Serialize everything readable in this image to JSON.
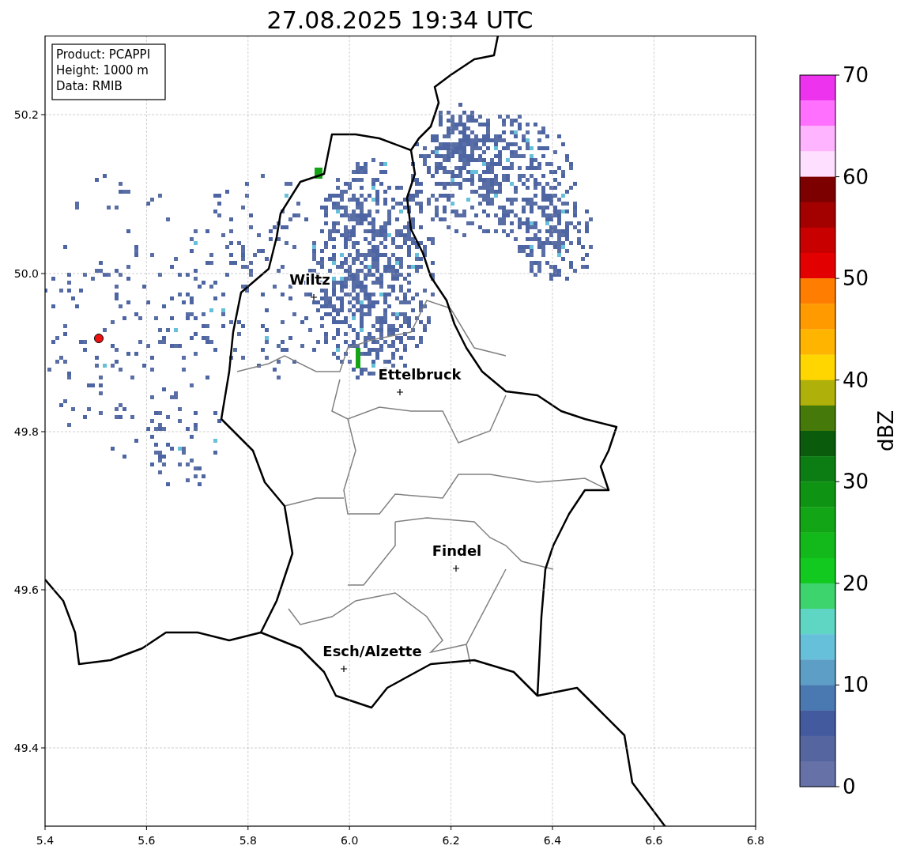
{
  "title": "27.08.2025 19:34 UTC",
  "info_box": [
    "Product: PCAPPI",
    "Height: 1000 m",
    "Data: RMIB"
  ],
  "map": {
    "x_ticks": [
      "5.4",
      "5.6",
      "5.8",
      "6.0",
      "6.2",
      "6.4",
      "6.6",
      "6.8"
    ],
    "y_ticks": [
      "50.2",
      "50.0",
      "49.8",
      "49.6",
      "49.4"
    ],
    "cities": [
      {
        "name": "Wiltz"
      },
      {
        "name": "Ettelbruck"
      },
      {
        "name": "Findel"
      },
      {
        "name": "Esch/Alzette"
      }
    ]
  },
  "colorbar": {
    "label": "dBZ",
    "ticks": [
      "70",
      "60",
      "50",
      "40",
      "30",
      "20",
      "10",
      "0"
    ],
    "segments": [
      {
        "color": "#ee33ee"
      },
      {
        "color": "#ff70ff"
      },
      {
        "color": "#ffb4ff"
      },
      {
        "color": "#ffdfff"
      },
      {
        "color": "#7d0000"
      },
      {
        "color": "#a30000"
      },
      {
        "color": "#c80000"
      },
      {
        "color": "#e30000"
      },
      {
        "color": "#ff7d00"
      },
      {
        "color": "#ff9a00"
      },
      {
        "color": "#ffb400"
      },
      {
        "color": "#ffd600"
      },
      {
        "color": "#b0b00a"
      },
      {
        "color": "#457a0a"
      },
      {
        "color": "#0a5c0c"
      },
      {
        "color": "#0c7d12"
      },
      {
        "color": "#0e9312"
      },
      {
        "color": "#12a515"
      },
      {
        "color": "#13b81a"
      },
      {
        "color": "#12c91f"
      },
      {
        "color": "#3dd46e"
      },
      {
        "color": "#5fd6c4"
      },
      {
        "color": "#66c0da"
      },
      {
        "color": "#5c9ec6"
      },
      {
        "color": "#4a78b0"
      },
      {
        "color": "#435a9f"
      },
      {
        "color": "#5565a0"
      },
      {
        "color": "#6571a7"
      }
    ]
  }
}
